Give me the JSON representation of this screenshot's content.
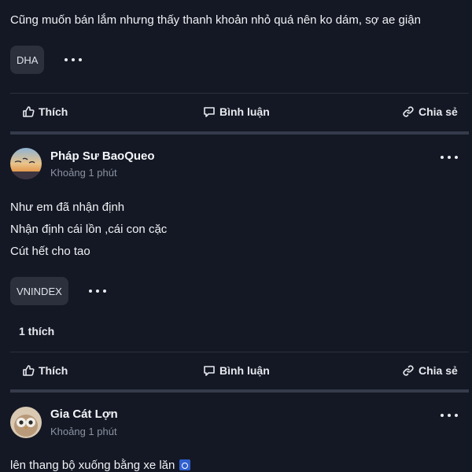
{
  "post1": {
    "text": "Cũng muốn bán lắm nhưng thấy thanh khoản nhỏ quá nên ko dám, sợ ae giận",
    "tag": "DHA"
  },
  "actions": {
    "like": "Thích",
    "comment": "Bình luận",
    "share": "Chia sẻ"
  },
  "post2": {
    "author": "Pháp Sư BaoQueo",
    "time": "Khoảng 1 phút",
    "lines": [
      "Như em đã nhận định",
      "Nhận định cái lồn ,cái con cặc",
      "Cút hết cho tao"
    ],
    "tag": "VNINDEX",
    "likes": "1 thích"
  },
  "post3": {
    "author": "Gia Cát Lợn",
    "time": "Khoảng 1 phút",
    "text": "lên thang bộ xuống bằng xe lăn"
  },
  "icons": {
    "like": "thumbs-up-icon",
    "comment": "comment-icon",
    "share": "link-icon",
    "more": "more-horizontal-icon",
    "wheelchair": "wheelchair-emoji"
  }
}
